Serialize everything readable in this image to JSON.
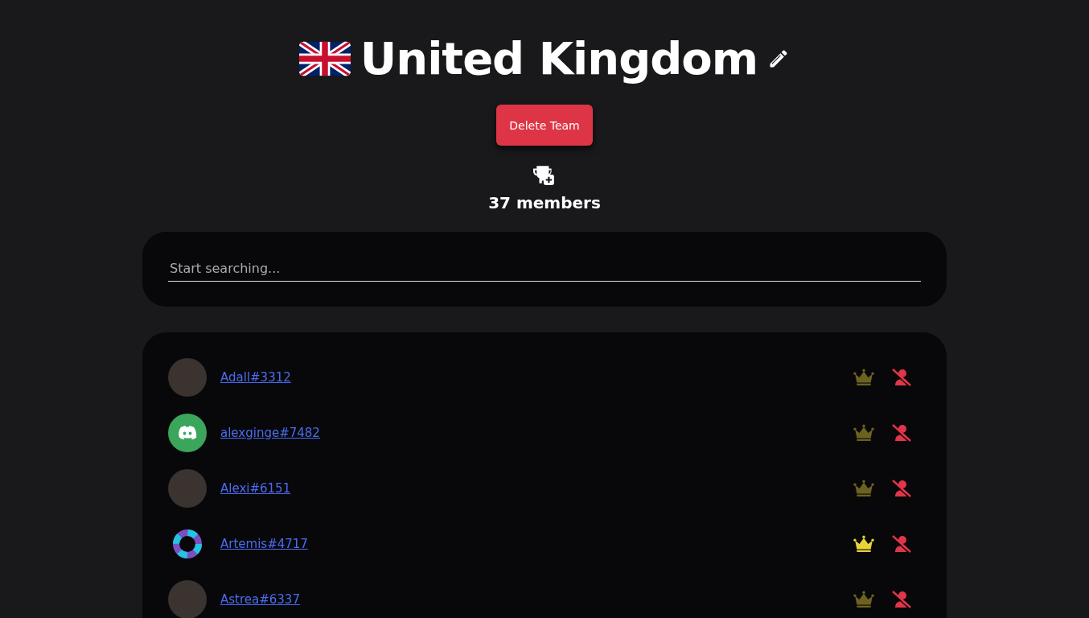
{
  "team": {
    "name": "United Kingdom",
    "member_count": "37 members"
  },
  "delete_button": "Delete Team",
  "search": {
    "placeholder": "Start searching..."
  },
  "members": [
    {
      "name": "Adall#3312",
      "kind": "photo",
      "captain": false
    },
    {
      "name": "alexginge#7482",
      "kind": "default",
      "captain": false
    },
    {
      "name": "Alexi#6151",
      "kind": "photo",
      "captain": false
    },
    {
      "name": "Artemis#4717",
      "kind": "ring",
      "captain": true
    },
    {
      "name": "Astrea#6337",
      "kind": "photo",
      "captain": false
    }
  ]
}
